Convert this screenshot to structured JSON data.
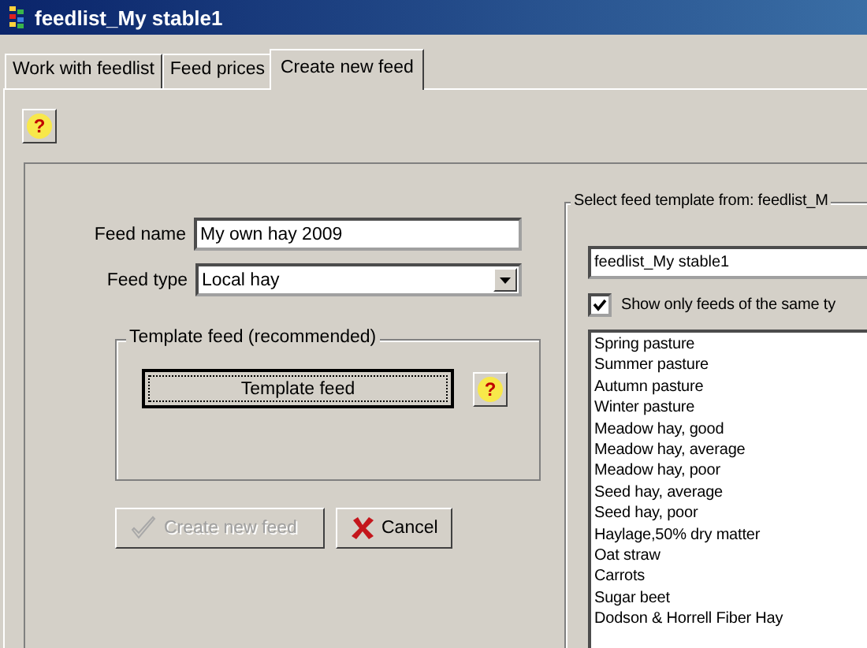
{
  "window": {
    "title": "feedlist_My stable1"
  },
  "help_button": {
    "label": "?"
  },
  "tabs": [
    {
      "label": "Work with feedlist",
      "selected": false
    },
    {
      "label": "Feed prices",
      "selected": false
    },
    {
      "label": "Create new feed",
      "selected": true
    }
  ],
  "form": {
    "feed_name": {
      "label": "Feed name",
      "value": "My own hay 2009"
    },
    "feed_type": {
      "label": "Feed type",
      "value": "Local hay"
    }
  },
  "template_group": {
    "title": "Template feed (recommended)",
    "button": "Template feed",
    "help_label": "?"
  },
  "buttons": [
    {
      "kind": "create",
      "label": "Create new feed",
      "disabled": true
    },
    {
      "kind": "cancel",
      "label": "Cancel",
      "disabled": false
    }
  ],
  "template_panel": {
    "title": "Select feed template from: feedlist_M",
    "source": "feedlist_My stable1",
    "filter": {
      "label": "Show only feeds of the same ty",
      "checked": true
    },
    "feeds": [
      "Spring pasture",
      "Summer pasture",
      "Autumn pasture",
      "Winter pasture",
      "Meadow hay, good",
      "Meadow hay, average",
      "Meadow hay, poor",
      "Seed hay, average",
      "Seed hay, poor",
      "Haylage,50% dry matter",
      "Oat straw",
      "Carrots",
      "Sugar beet",
      "Dodson & Horrell Fiber Hay"
    ]
  }
}
